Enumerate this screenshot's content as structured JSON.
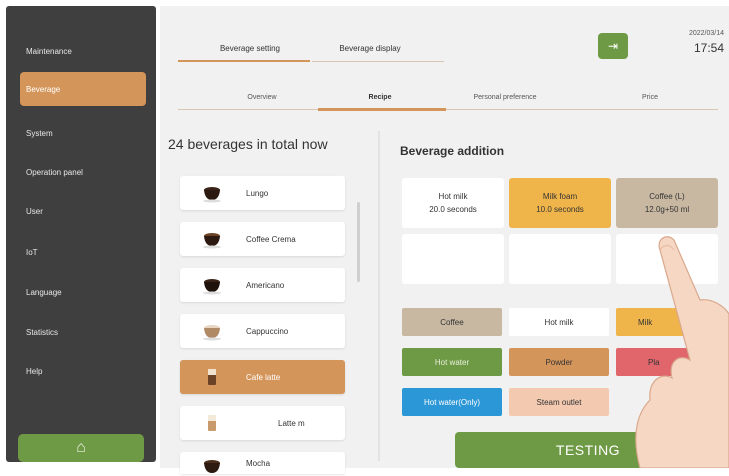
{
  "sidebar": {
    "items": [
      {
        "label": "Maintenance"
      },
      {
        "label": "Beverage"
      },
      {
        "label": "System"
      },
      {
        "label": "Operation panel"
      },
      {
        "label": "User"
      },
      {
        "label": "IoT"
      },
      {
        "label": "Language"
      },
      {
        "label": "Statistics"
      },
      {
        "label": "Help"
      }
    ],
    "home_icon": "⌂"
  },
  "header": {
    "tabs": [
      "Beverage setting",
      "Beverage display"
    ],
    "subtabs": [
      "Overview",
      "Recipe",
      "Personal preference",
      "Price"
    ],
    "exit_icon": "⇥",
    "date": "2022/03/14",
    "time": "17:54"
  },
  "beverage_list": {
    "count_label": "24 beverages in total now",
    "items": [
      "Lungo",
      "Coffee Crema",
      "Americano",
      "Cappuccino",
      "Cafe latte",
      "Latte m",
      "Mocha"
    ]
  },
  "addition": {
    "title": "Beverage addition",
    "cards": [
      {
        "name": "Hot milk",
        "value": "20.0 seconds"
      },
      {
        "name": "Milk foam",
        "value": "10.0 seconds"
      },
      {
        "name": "Coffee (L)",
        "value": "12.0g+50 ml"
      }
    ],
    "chips": [
      "Coffee",
      "Hot milk",
      "Milk",
      "Hot water",
      "Powder",
      "Pla",
      "Hot water(Only)",
      "Steam outlet"
    ]
  },
  "testing_label": "TESTING",
  "colors": {
    "sidebar": "#3f3f3f",
    "accent_orange": "#d4955a",
    "accent_green": "#6f9a45",
    "coffee_beige": "#c8b8a2",
    "hot_water_green": "#6f9a45",
    "powder_tan": "#d4955a",
    "pla_red": "#e0666c",
    "only_blue": "#2c97d6",
    "steam_peach": "#f3c9b0"
  }
}
